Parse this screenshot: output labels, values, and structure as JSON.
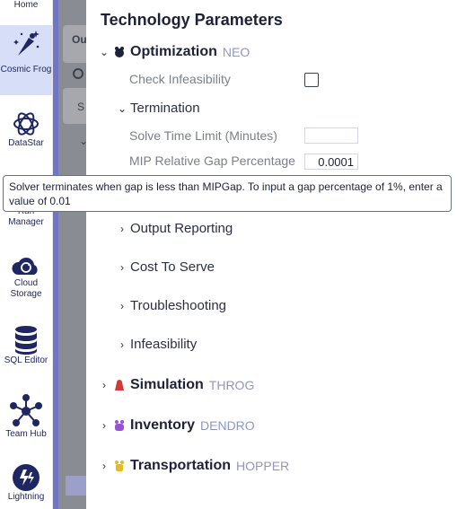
{
  "rail": {
    "items": [
      {
        "label": "Home"
      },
      {
        "label": "Cosmic Frog"
      },
      {
        "label": "DataStar"
      },
      {
        "label": "Run Manager"
      },
      {
        "label": "Cloud Storage"
      },
      {
        "label": "SQL Editor"
      },
      {
        "label": "Team Hub"
      },
      {
        "label": "Lightning"
      }
    ],
    "accent_color": "#1e2761",
    "active_bg": "#d7def8"
  },
  "background_app": {
    "tab_text": "Ou",
    "field_text": "S"
  },
  "panel": {
    "title": "Technology Parameters",
    "optimization": {
      "title": "Optimization",
      "code": "NEO",
      "check_infeasibility_label": "Check Infeasibility",
      "check_infeasibility_checked": false,
      "termination": {
        "title": "Termination",
        "solve_time_limit_label": "Solve Time Limit (Minutes)",
        "solve_time_limit_value": "",
        "mip_gap_label": "MIP Relative Gap Percentage",
        "mip_gap_value": "0.0001"
      },
      "subsections": [
        "Output Reporting",
        "Cost To Serve",
        "Troubleshooting",
        "Infeasibility"
      ]
    },
    "sections": [
      {
        "title": "Simulation",
        "code": "THROG",
        "icon": "throg-icon",
        "color": "#d23a3a"
      },
      {
        "title": "Inventory",
        "code": "DENDRO",
        "icon": "dendro-icon",
        "color": "#9b4fd6"
      },
      {
        "title": "Transportation",
        "code": "HOPPER",
        "icon": "hopper-icon",
        "color": "#e7b923"
      }
    ]
  },
  "tooltip": {
    "text": "Solver terminates when gap is less than MIPGap. To input a gap percentage of 1%, enter a value of 0.01"
  }
}
